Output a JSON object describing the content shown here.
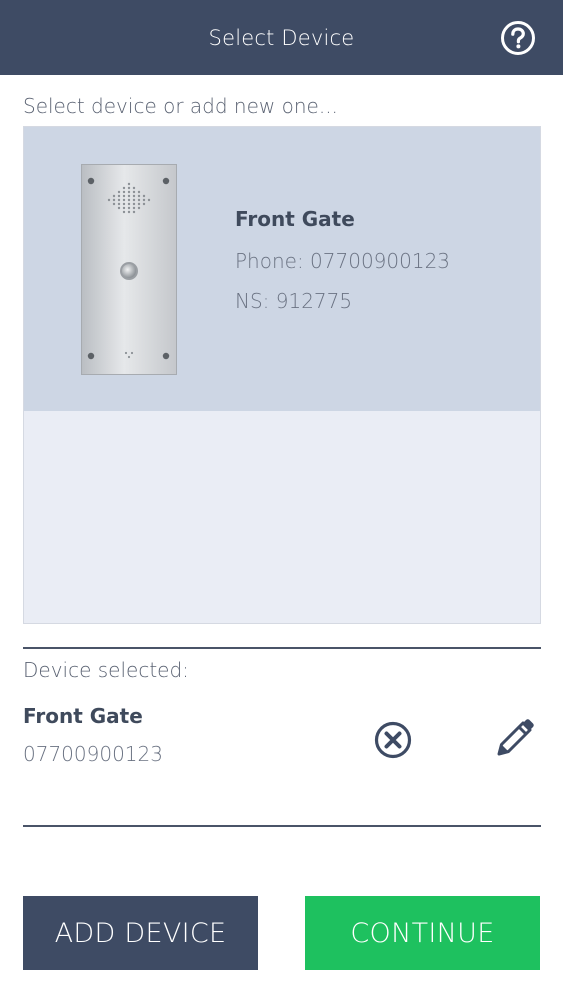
{
  "header": {
    "title": "Select Device",
    "help_icon": "question-circle-icon"
  },
  "prompt": "Select device or add new one...",
  "devices": [
    {
      "name": "Front Gate",
      "phone_line": "Phone: 07700900123",
      "ns_line": "NS: 912775",
      "image_icon": "intercom-panel-icon"
    }
  ],
  "selected": {
    "label": "Device selected:",
    "name": "Front Gate",
    "phone": "07700900123",
    "remove_icon": "close-circle-icon",
    "edit_icon": "pencil-icon"
  },
  "buttons": {
    "add_device": "ADD DEVICE",
    "continue": "CONTINUE"
  },
  "colors": {
    "header_bg": "#3e4b64",
    "selected_card_bg": "#cdd6e4",
    "list_bg": "#eaedf5",
    "continue_bg": "#1ec15f"
  }
}
